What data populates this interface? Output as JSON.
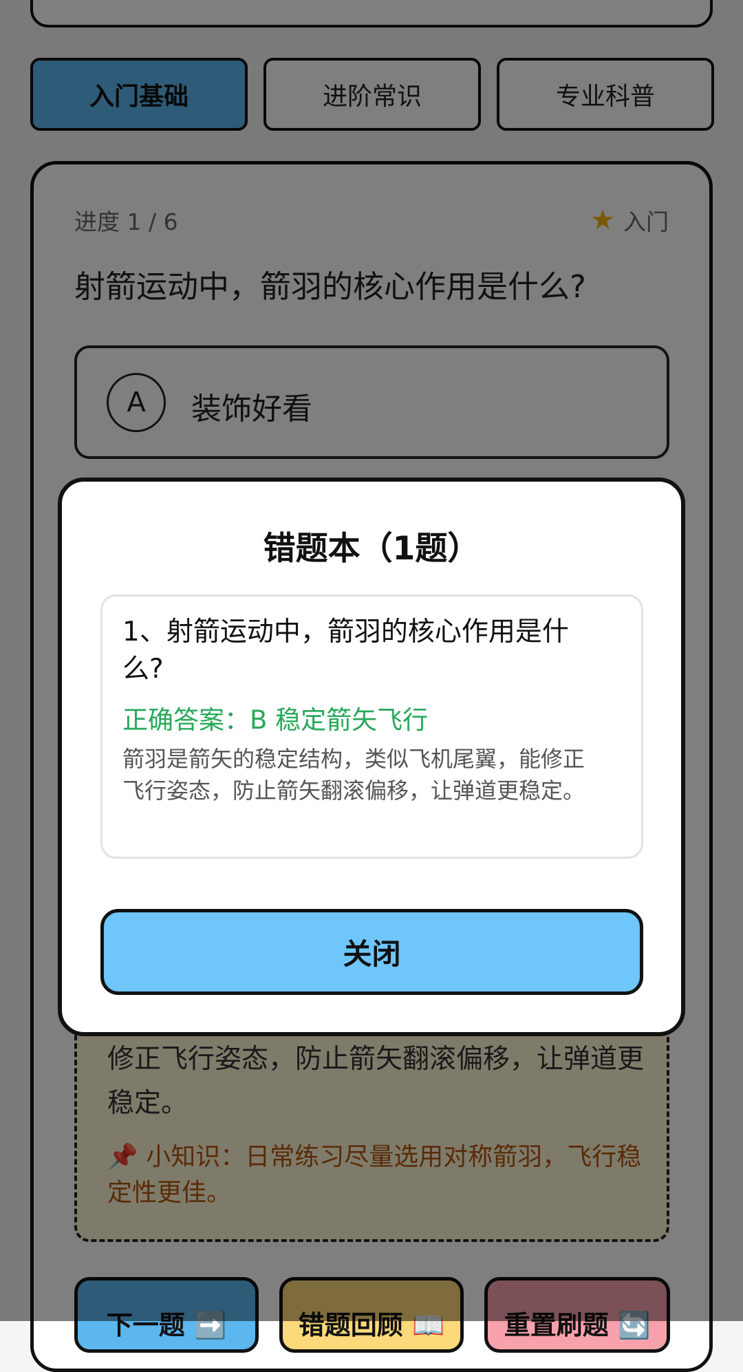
{
  "tabs": [
    {
      "label": "入门基础",
      "active": true
    },
    {
      "label": "进阶常识",
      "active": false
    },
    {
      "label": "专业科普",
      "active": false
    }
  ],
  "quiz": {
    "progress": "进度 1 / 6",
    "level_icon": "star-icon",
    "level": "入门",
    "question": "射箭运动中，箭羽的核心作用是什么?",
    "option": {
      "letter": "A",
      "text": "装饰好看"
    },
    "explanation": "修正飞行姿态，防止箭矢翻滚偏移，让弹道更稳定。",
    "tip": "📌 小知识：日常练习尽量选用对称箭羽，飞行稳定性更佳。"
  },
  "bottom_buttons": {
    "next": "下一题 ➡️",
    "review": "错题回顾 📖",
    "reset": "重置刷题 🔄"
  },
  "modal": {
    "title": "错题本（1题）",
    "item_question": "1、射箭运动中，箭羽的核心作用是什么?",
    "item_answer": "正确答案：B 稳定箭矢飞行",
    "item_explanation": "箭羽是箭矢的稳定结构，类似飞机尾翼，能修正飞行姿态，防止箭矢翻滚偏移，让弹道更稳定。",
    "close_label": "关闭"
  },
  "colors": {
    "active_tab": "#5db7ef",
    "close_button": "#6ec6fb",
    "answer_text": "#28a85a",
    "tip_text": "#b2560e"
  }
}
